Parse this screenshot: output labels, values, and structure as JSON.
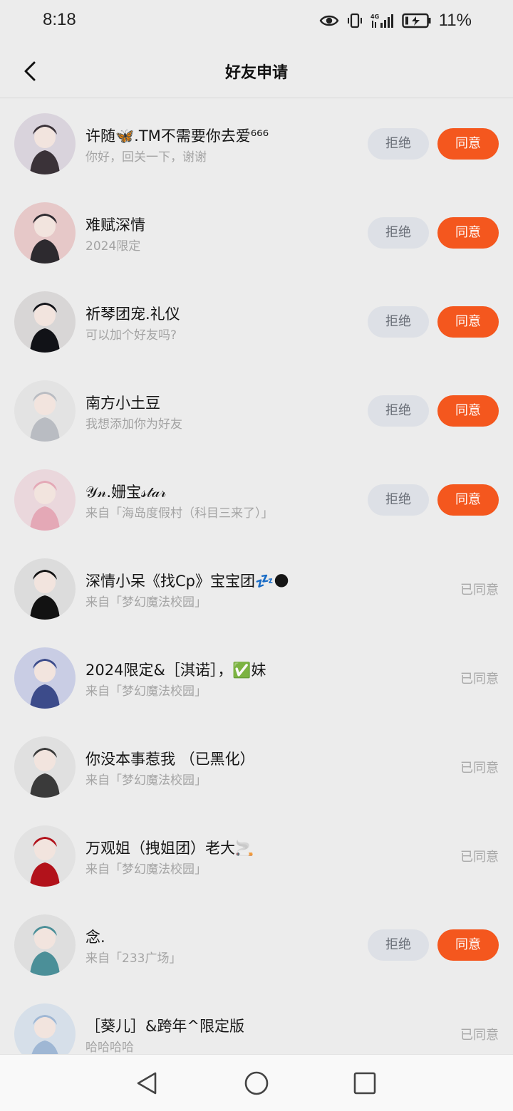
{
  "status_bar": {
    "time": "8:18",
    "battery": "11%"
  },
  "header": {
    "title": "好友申请"
  },
  "buttons": {
    "reject": "拒绝",
    "accept": "同意",
    "agreed": "已同意"
  },
  "requests": [
    {
      "name": "许随🦋.TM不需要你去爱⁶⁶⁶",
      "sub": "你好，回关一下，谢谢",
      "status": "pending",
      "avatar_bg": "#d9d3dc",
      "avatar_fg": "#3a3238"
    },
    {
      "name": "难赋深情",
      "sub": "2024限定",
      "status": "pending",
      "avatar_bg": "#e6c8c8",
      "avatar_fg": "#2d2a2f"
    },
    {
      "name": "祈琴团宠.礼仪",
      "sub": "可以加个好友吗?",
      "status": "pending",
      "avatar_bg": "#d8d6d6",
      "avatar_fg": "#111217"
    },
    {
      "name": "南方小土豆",
      "sub": "我想添加你为好友",
      "status": "pending",
      "avatar_bg": "#e3e3e3",
      "avatar_fg": "#b9bcc2"
    },
    {
      "name": "𝒴𝓃.姗宝𝓈𝓉𝒶𝓇",
      "sub": "来自「海岛度假村（科目三来了）」",
      "status": "pending",
      "avatar_bg": "#ead7dc",
      "avatar_fg": "#e4a8b6"
    },
    {
      "name": "深情小呆《找Cp》宝宝团💤🌑",
      "sub": "来自「梦幻魔法校园」",
      "status": "agreed",
      "avatar_bg": "#dcdcdc",
      "avatar_fg": "#121212"
    },
    {
      "name": "2024限定&［淇诺］，✅妹",
      "sub": "来自「梦幻魔法校园」",
      "status": "agreed",
      "avatar_bg": "#c9cde4",
      "avatar_fg": "#3c4b8a"
    },
    {
      "name": "你没本事惹我 （已黑化）",
      "sub": "来自「梦幻魔法校园」",
      "status": "agreed",
      "avatar_bg": "#e0e0e0",
      "avatar_fg": "#3a3a3a"
    },
    {
      "name": "万观姐（拽姐团）老大🚬",
      "sub": "来自「梦幻魔法校园」",
      "status": "agreed",
      "avatar_bg": "#e2e2e2",
      "avatar_fg": "#b2121b"
    },
    {
      "name": "念.",
      "sub": "来自「233广场」",
      "status": "pending",
      "avatar_bg": "#dedede",
      "avatar_fg": "#4b8f98"
    },
    {
      "name": "［葵儿］&跨年^限定版",
      "sub": "哈哈哈哈",
      "status": "agreed",
      "avatar_bg": "#d6dfe9",
      "avatar_fg": "#9fb7d4"
    }
  ],
  "icons": {
    "back": "chevron-left-icon",
    "eye": "eye-icon",
    "vibrate": "vibrate-icon",
    "signal": "signal-4g-icon",
    "battery": "battery-charging-icon",
    "nav_back": "triangle-back-icon",
    "nav_home": "circle-home-icon",
    "nav_recents": "square-recents-icon"
  },
  "colors": {
    "accent": "#f4571e",
    "reject_bg": "#dde0e6",
    "page_bg": "#ececec"
  }
}
